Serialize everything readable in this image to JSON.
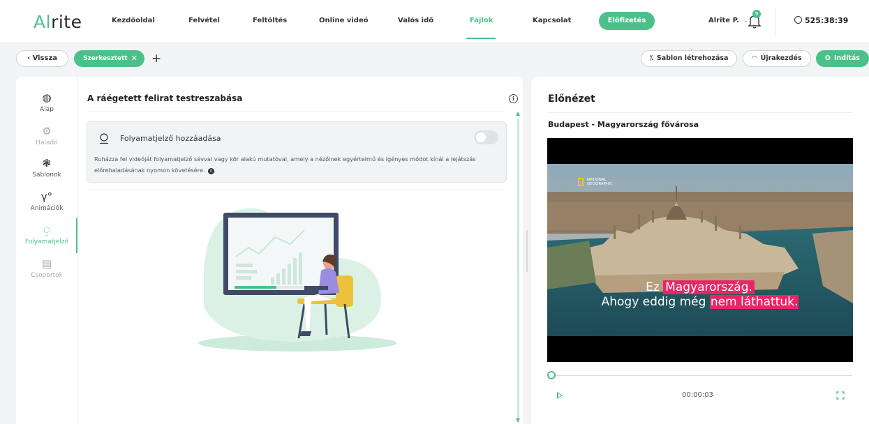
{
  "app": {
    "logo": "Alrite",
    "colors": {
      "accent": "#4cc08a",
      "subtitle_highlight": "#ea2566"
    }
  },
  "nav": {
    "items": [
      {
        "label": "Kezdőoldal"
      },
      {
        "label": "Felvétel"
      },
      {
        "label": "Feltöltés"
      },
      {
        "label": "Online videó"
      },
      {
        "label": "Valós idő"
      },
      {
        "label": "Fájlok",
        "active": true
      },
      {
        "label": "Kapcsolat"
      }
    ],
    "subscribe_label": "Előfizetés",
    "user_name": "Alrite P.",
    "notification_count": "9",
    "timer": "525:38:39"
  },
  "toolbar": {
    "back_label": "Vissza",
    "tab_chip_label": "Szerkesztett",
    "add_label": "+",
    "create_template_label": "Sablon létrehozása",
    "restart_label": "Újrakezdés",
    "start_label": "Indítás"
  },
  "sidebar": {
    "items": [
      {
        "label": "Alap",
        "icon": "palette-icon"
      },
      {
        "label": "Haladó",
        "icon": "advanced-icon",
        "muted": true
      },
      {
        "label": "Sablonok",
        "icon": "templates-icon"
      },
      {
        "label": "Animációk",
        "icon": "animation-icon"
      },
      {
        "label": "Folyamatjelző",
        "icon": "progress-icon",
        "active": true
      },
      {
        "label": "Csoportok",
        "icon": "groups-icon",
        "muted": true
      }
    ]
  },
  "main": {
    "title": "A ráégetett felirat testreszabása",
    "card": {
      "title": "Folyamatjelző hozzáadása",
      "toggle_on": false,
      "description": "Ruházza fel videóját folyamatjelző sávval vagy kör alakú mutatóval, amely a nézőinek egyértelmű és igényes módot kínál a lejátszás előrehaladásának nyomon követésére."
    }
  },
  "preview": {
    "title": "Előnézet",
    "video_title": "Budapest - Magyarország fővárosa",
    "watermark_line1": "NATIONAL",
    "watermark_line2": "GEOGRAPHIC",
    "subtitle_line1_plain": "Ez ",
    "subtitle_line1_highlight": "Magyarország.",
    "subtitle_line2_plain": "Ahogy eddig még ",
    "subtitle_line2_highlight": "nem láthattuk.",
    "current_time": "00:00:03",
    "progress": 0.0
  }
}
